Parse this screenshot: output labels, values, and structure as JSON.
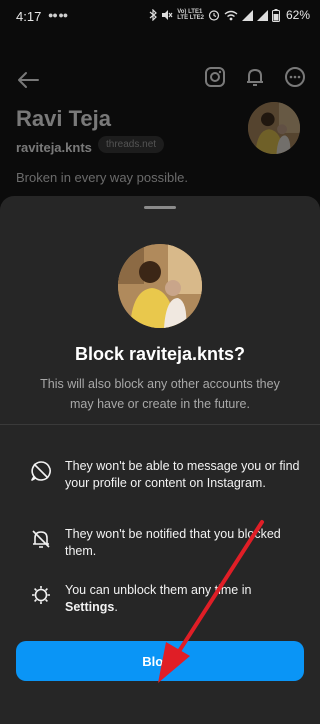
{
  "status_bar": {
    "time": "4:17",
    "sim_icons": "●● ●●",
    "net_top": "Vo) LTE1",
    "net_bottom": "LTE LTE2",
    "battery": "62%"
  },
  "profile": {
    "name": "Ravi Teja",
    "handle": "raviteja.knts",
    "badge": "threads.net",
    "bio": "Broken in every way possible."
  },
  "sheet": {
    "title": "Block raviteja.knts?",
    "subtitle": "This will also block any other accounts they may have or create in the future.",
    "items": [
      {
        "icon": "message-slash-icon",
        "text": "They won't be able to message you or find your profile or content on Instagram."
      },
      {
        "icon": "bell-slash-icon",
        "text": "They won't be notified that you blocked them."
      },
      {
        "icon": "settings-gear-icon",
        "text_before": "You can unblock them any time in ",
        "text_bold": "Settings",
        "text_after": "."
      }
    ],
    "block_button": "Block"
  },
  "colors": {
    "accent": "#0a95f6",
    "sheet_bg": "#262626",
    "annotation_arrow": "#e01e26"
  }
}
